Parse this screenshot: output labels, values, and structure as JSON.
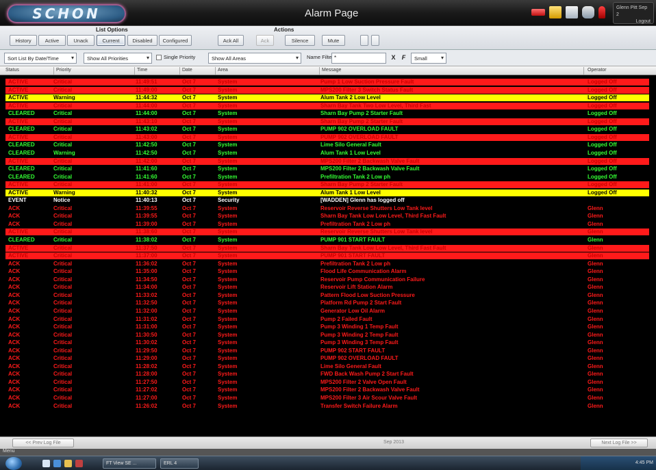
{
  "window": {
    "logo": "SCHON",
    "title": "Alarm Page",
    "user": {
      "line1": "Glenn Pitt Sep 2",
      "line2": "Logout"
    }
  },
  "toolbar": {
    "list_options_label": "List Options",
    "actions_label": "Actions",
    "list_buttons": [
      "History",
      "Active",
      "Unack",
      "Current",
      "Disabled",
      "Configured"
    ],
    "active_list_button": "Current",
    "ack_all": "Ack All",
    "ack_short": "Ack",
    "action_buttons": [
      "Silence",
      "Mute"
    ]
  },
  "filters": {
    "sort": "Sort List By Date/Time",
    "priorities": "Show All Priorities",
    "single_priority": "Single Priority",
    "areas": "Show All Areas",
    "name_filter_label": "Name Filter",
    "name_filter_value": "*",
    "clear_icon": "X",
    "refresh_icon": "F",
    "sound": "Small"
  },
  "columns": [
    "Status",
    "Priority",
    "Time",
    "Date",
    "Area",
    "Message",
    "Operator"
  ],
  "colors": {
    "red": "#ff1a1a",
    "dark_red": "#cc0000",
    "yellow": "#ffff00",
    "green": "#33ff33",
    "white": "#ffffff",
    "black": "#000000"
  },
  "alarms": [
    {
      "status": "ACTIVE",
      "priority": "Critical",
      "time": "11:49:51",
      "date": "Oct 7",
      "area": "System",
      "message": "Pump 1 Low Suction Pressure Fault",
      "operator": "Logged Off",
      "bg": "red",
      "fg": "dark_red"
    },
    {
      "status": "ACTIVE",
      "priority": "Critical",
      "time": "11:49:00",
      "date": "Oct 7",
      "area": "System",
      "message": "MPS200 Filter 3 Switch Status Fault",
      "operator": "Logged Off",
      "bg": "red",
      "fg": "dark_red"
    },
    {
      "status": "ACTIVE",
      "priority": "Warning",
      "time": "11:44:32",
      "date": "Oct 7",
      "area": "System",
      "message": "Alum Tank 2 Low Level",
      "operator": "Logged Off",
      "bg": "yellow",
      "fg": "black"
    },
    {
      "status": "ACTIVE",
      "priority": "Critical",
      "time": "11:44:00",
      "date": "Oct 7",
      "area": "System",
      "message": "Sharn Bay Tank Two Low Level, Third Fast",
      "operator": "Logged Off",
      "bg": "red",
      "fg": "dark_red"
    },
    {
      "status": "CLEARED",
      "priority": "Critical",
      "time": "11:44:00",
      "date": "Oct 7",
      "area": "System",
      "message": "Sharn Bay Pump 2 Starter Fault",
      "operator": "Logged Off",
      "bg": "black",
      "fg": "green"
    },
    {
      "status": "ACTIVE",
      "priority": "Critical",
      "time": "11:43:10",
      "date": "Oct 7",
      "area": "System",
      "message": "Sharn Bay Pump 2 Starter Fault",
      "operator": "Logged Off",
      "bg": "red",
      "fg": "dark_red"
    },
    {
      "status": "CLEARED",
      "priority": "Critical",
      "time": "11:43:02",
      "date": "Oct 7",
      "area": "System",
      "message": "PUMP 902 OVERLOAD FAULT",
      "operator": "Logged Off",
      "bg": "black",
      "fg": "green"
    },
    {
      "status": "ACTIVE",
      "priority": "Critical",
      "time": "11:43:00",
      "date": "Oct 7",
      "area": "System",
      "message": "PUMP 902 OVERLOAD FAULT",
      "operator": "Logged Off",
      "bg": "red",
      "fg": "dark_red"
    },
    {
      "status": "CLEARED",
      "priority": "Critical",
      "time": "11:42:50",
      "date": "Oct 7",
      "area": "System",
      "message": "Lime Silo General Fault",
      "operator": "Logged Off",
      "bg": "black",
      "fg": "green"
    },
    {
      "status": "CLEARED",
      "priority": "Warning",
      "time": "11:42:50",
      "date": "Oct 7",
      "area": "System",
      "message": "Alum Tank 1 Low Level",
      "operator": "Logged Off",
      "bg": "black",
      "fg": "green"
    },
    {
      "status": "ACTIVE",
      "priority": "Critical",
      "time": "11:42:00",
      "date": "Oct 7",
      "area": "System",
      "message": "MPS200 Filter 2 Backwash Valve Fault",
      "operator": "Logged Off",
      "bg": "red",
      "fg": "dark_red"
    },
    {
      "status": "CLEARED",
      "priority": "Critical",
      "time": "11:41:60",
      "date": "Oct 7",
      "area": "System",
      "message": "MPS200 Filter 2 Backwash Valve Fault",
      "operator": "Logged Off",
      "bg": "black",
      "fg": "green"
    },
    {
      "status": "CLEARED",
      "priority": "Critical",
      "time": "11:41:60",
      "date": "Oct 7",
      "area": "System",
      "message": "Prefiltration Tank 2 Low ph",
      "operator": "Logged Off",
      "bg": "black",
      "fg": "green"
    },
    {
      "status": "ACTIVE",
      "priority": "Critical",
      "time": "11:41:00",
      "date": "Oct 7",
      "area": "System",
      "message": "Sharn Bay Pump 2 Starter Fault",
      "operator": "Logged Off",
      "bg": "red",
      "fg": "dark_red"
    },
    {
      "status": "ACTIVE",
      "priority": "Warning",
      "time": "11:40:32",
      "date": "Oct 7",
      "area": "System",
      "message": "Alum Tank 1 Low Level",
      "operator": "Logged Off",
      "bg": "yellow",
      "fg": "black"
    },
    {
      "status": "EVENT",
      "priority": "Notice",
      "time": "11:40:13",
      "date": "Oct 7",
      "area": "Security",
      "message": "[WADDEN] Glenn has logged off",
      "operator": "",
      "bg": "black",
      "fg": "white"
    },
    {
      "status": "ACK",
      "priority": "Critical",
      "time": "11:39:55",
      "date": "Oct 7",
      "area": "System",
      "message": "Reservoir Reverse Shutters Low Tank level",
      "operator": "Glenn",
      "bg": "black",
      "fg": "red"
    },
    {
      "status": "ACK",
      "priority": "Critical",
      "time": "11:39:55",
      "date": "Oct 7",
      "area": "System",
      "message": "Sharn Bay Tank Low Low Level, Third Fast Fault",
      "operator": "Glenn",
      "bg": "black",
      "fg": "red"
    },
    {
      "status": "ACK",
      "priority": "Critical",
      "time": "11:39:00",
      "date": "Oct 7",
      "area": "System",
      "message": "Prefiltration Tank 2 Low ph",
      "operator": "Glenn",
      "bg": "black",
      "fg": "red"
    },
    {
      "status": "ACTIVE",
      "priority": "Critical",
      "time": "11:38:60",
      "date": "Oct 7",
      "area": "System",
      "message": "Reservoir Reverse Shutters Low Tank level",
      "operator": "Glenn",
      "bg": "red",
      "fg": "dark_red"
    },
    {
      "status": "CLEARED",
      "priority": "Critical",
      "time": "11:38:02",
      "date": "Oct 7",
      "area": "System",
      "message": "PUMP 901 START FAULT",
      "operator": "Glenn",
      "bg": "black",
      "fg": "green"
    },
    {
      "status": "ACTIVE",
      "priority": "Critical",
      "time": "11:37:50",
      "date": "Oct 7",
      "area": "System",
      "message": "Sharn Bay Tank Low Low Level, Third Fast Fault",
      "operator": "Glenn",
      "bg": "red",
      "fg": "dark_red"
    },
    {
      "status": "ACTIVE",
      "priority": "Critical",
      "time": "11:37:00",
      "date": "Oct 7",
      "area": "System",
      "message": "PUMP 901 START FAULT",
      "operator": "Glenn",
      "bg": "red",
      "fg": "dark_red"
    },
    {
      "status": "ACK",
      "priority": "Critical",
      "time": "11:36:02",
      "date": "Oct 7",
      "area": "System",
      "message": "Prefiltration Tank 2 Low ph",
      "operator": "Glenn",
      "bg": "black",
      "fg": "red"
    },
    {
      "status": "ACK",
      "priority": "Critical",
      "time": "11:35:00",
      "date": "Oct 7",
      "area": "System",
      "message": "Flood Life Communication Alarm",
      "operator": "Glenn",
      "bg": "black",
      "fg": "red"
    },
    {
      "status": "ACK",
      "priority": "Critical",
      "time": "11:34:50",
      "date": "Oct 7",
      "area": "System",
      "message": "Reservoir Pump Communication Failure",
      "operator": "Glenn",
      "bg": "black",
      "fg": "red"
    },
    {
      "status": "ACK",
      "priority": "Critical",
      "time": "11:34:00",
      "date": "Oct 7",
      "area": "System",
      "message": "Reservoir Lift Station Alarm",
      "operator": "Glenn",
      "bg": "black",
      "fg": "red"
    },
    {
      "status": "ACK",
      "priority": "Critical",
      "time": "11:33:02",
      "date": "Oct 7",
      "area": "System",
      "message": "Pattern Flood Low Suction Pressure",
      "operator": "Glenn",
      "bg": "black",
      "fg": "red"
    },
    {
      "status": "ACK",
      "priority": "Critical",
      "time": "11:32:50",
      "date": "Oct 7",
      "area": "System",
      "message": "Platform Rd Pump 2 Start Fault",
      "operator": "Glenn",
      "bg": "black",
      "fg": "red"
    },
    {
      "status": "ACK",
      "priority": "Critical",
      "time": "11:32:00",
      "date": "Oct 7",
      "area": "System",
      "message": "Generator Low Oil Alarm",
      "operator": "Glenn",
      "bg": "black",
      "fg": "red"
    },
    {
      "status": "ACK",
      "priority": "Critical",
      "time": "11:31:02",
      "date": "Oct 7",
      "area": "System",
      "message": "Pump 2 Failed Fault",
      "operator": "Glenn",
      "bg": "black",
      "fg": "red"
    },
    {
      "status": "ACK",
      "priority": "Critical",
      "time": "11:31:00",
      "date": "Oct 7",
      "area": "System",
      "message": "Pump 3 Winding 1 Temp Fault",
      "operator": "Glenn",
      "bg": "black",
      "fg": "red"
    },
    {
      "status": "ACK",
      "priority": "Critical",
      "time": "11:30:50",
      "date": "Oct 7",
      "area": "System",
      "message": "Pump 3 Winding 2 Temp Fault",
      "operator": "Glenn",
      "bg": "black",
      "fg": "red"
    },
    {
      "status": "ACK",
      "priority": "Critical",
      "time": "11:30:02",
      "date": "Oct 7",
      "area": "System",
      "message": "Pump 3 Winding 3 Temp Fault",
      "operator": "Glenn",
      "bg": "black",
      "fg": "red"
    },
    {
      "status": "ACK",
      "priority": "Critical",
      "time": "11:29:50",
      "date": "Oct 7",
      "area": "System",
      "message": "PUMP 902 START FAULT",
      "operator": "Glenn",
      "bg": "black",
      "fg": "red"
    },
    {
      "status": "ACK",
      "priority": "Critical",
      "time": "11:29:00",
      "date": "Oct 7",
      "area": "System",
      "message": "PUMP 902 OVERLOAD FAULT",
      "operator": "Glenn",
      "bg": "black",
      "fg": "red"
    },
    {
      "status": "ACK",
      "priority": "Critical",
      "time": "11:28:02",
      "date": "Oct 7",
      "area": "System",
      "message": "Lime Silo General Fault",
      "operator": "Glenn",
      "bg": "black",
      "fg": "red"
    },
    {
      "status": "ACK",
      "priority": "Critical",
      "time": "11:28:00",
      "date": "Oct 7",
      "area": "System",
      "message": "FWD Back Wash Pump 2 Start Fault",
      "operator": "Glenn",
      "bg": "black",
      "fg": "red"
    },
    {
      "status": "ACK",
      "priority": "Critical",
      "time": "11:27:50",
      "date": "Oct 7",
      "area": "System",
      "message": "MPS200 Filter 2 Valve Open Fault",
      "operator": "Glenn",
      "bg": "black",
      "fg": "red"
    },
    {
      "status": "ACK",
      "priority": "Critical",
      "time": "11:27:02",
      "date": "Oct 7",
      "area": "System",
      "message": "MPS200 Filter 2 Backwash Valve Fault",
      "operator": "Glenn",
      "bg": "black",
      "fg": "red"
    },
    {
      "status": "ACK",
      "priority": "Critical",
      "time": "11:27:00",
      "date": "Oct 7",
      "area": "System",
      "message": "MPS200 Filter 3 Air Scour Valve Fault",
      "operator": "Glenn",
      "bg": "black",
      "fg": "red"
    },
    {
      "status": "ACK",
      "priority": "Critical",
      "time": "11:26:02",
      "date": "Oct 7",
      "area": "System",
      "message": "Transfer Switch Failure Alarm",
      "operator": "Glenn",
      "bg": "black",
      "fg": "red"
    }
  ],
  "footer": {
    "prev": "<< Prev Log File",
    "center": "Sep 2013",
    "next": "Next Log File >>"
  },
  "statusbar": {
    "menu": "Menu"
  },
  "taskbar": {
    "tasks": [
      "FT View SE ...",
      "ERL 4"
    ],
    "clock": "4:45 PM"
  }
}
